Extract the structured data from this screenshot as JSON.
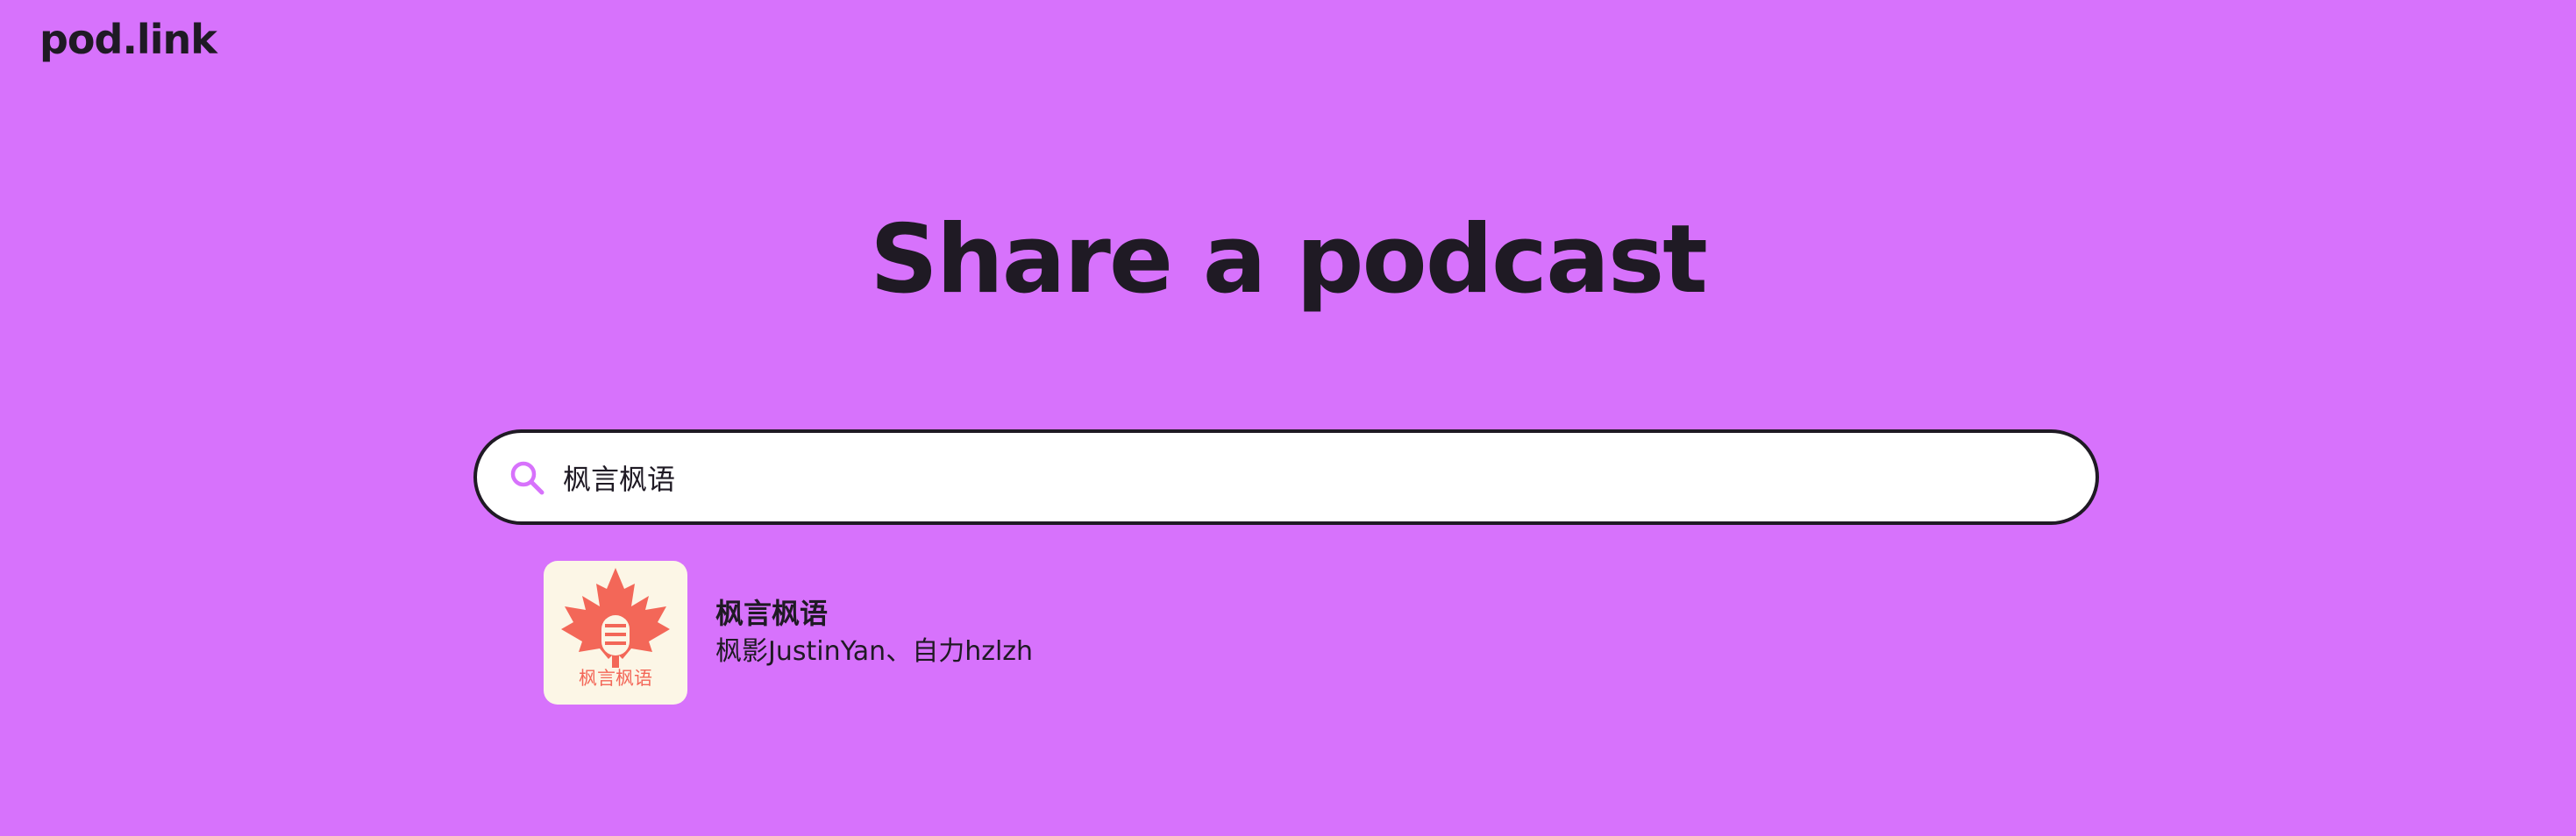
{
  "header": {
    "logo": "pod.link"
  },
  "main": {
    "title": "Share a podcast",
    "search": {
      "value": "枫言枫语",
      "icon": "search-icon"
    },
    "results": [
      {
        "artwork_icon": "maple-leaf-microphone-artwork",
        "artwork_caption": "枫言枫语",
        "title": "枫言枫语",
        "author": "枫影JustinYan、自力hzlzh"
      }
    ]
  },
  "colors": {
    "background": "#d772fc",
    "text": "#1f1a24",
    "search_icon": "#d772fc",
    "artwork_background": "#fcf6e6",
    "artwork_leaf": "#f36758"
  }
}
